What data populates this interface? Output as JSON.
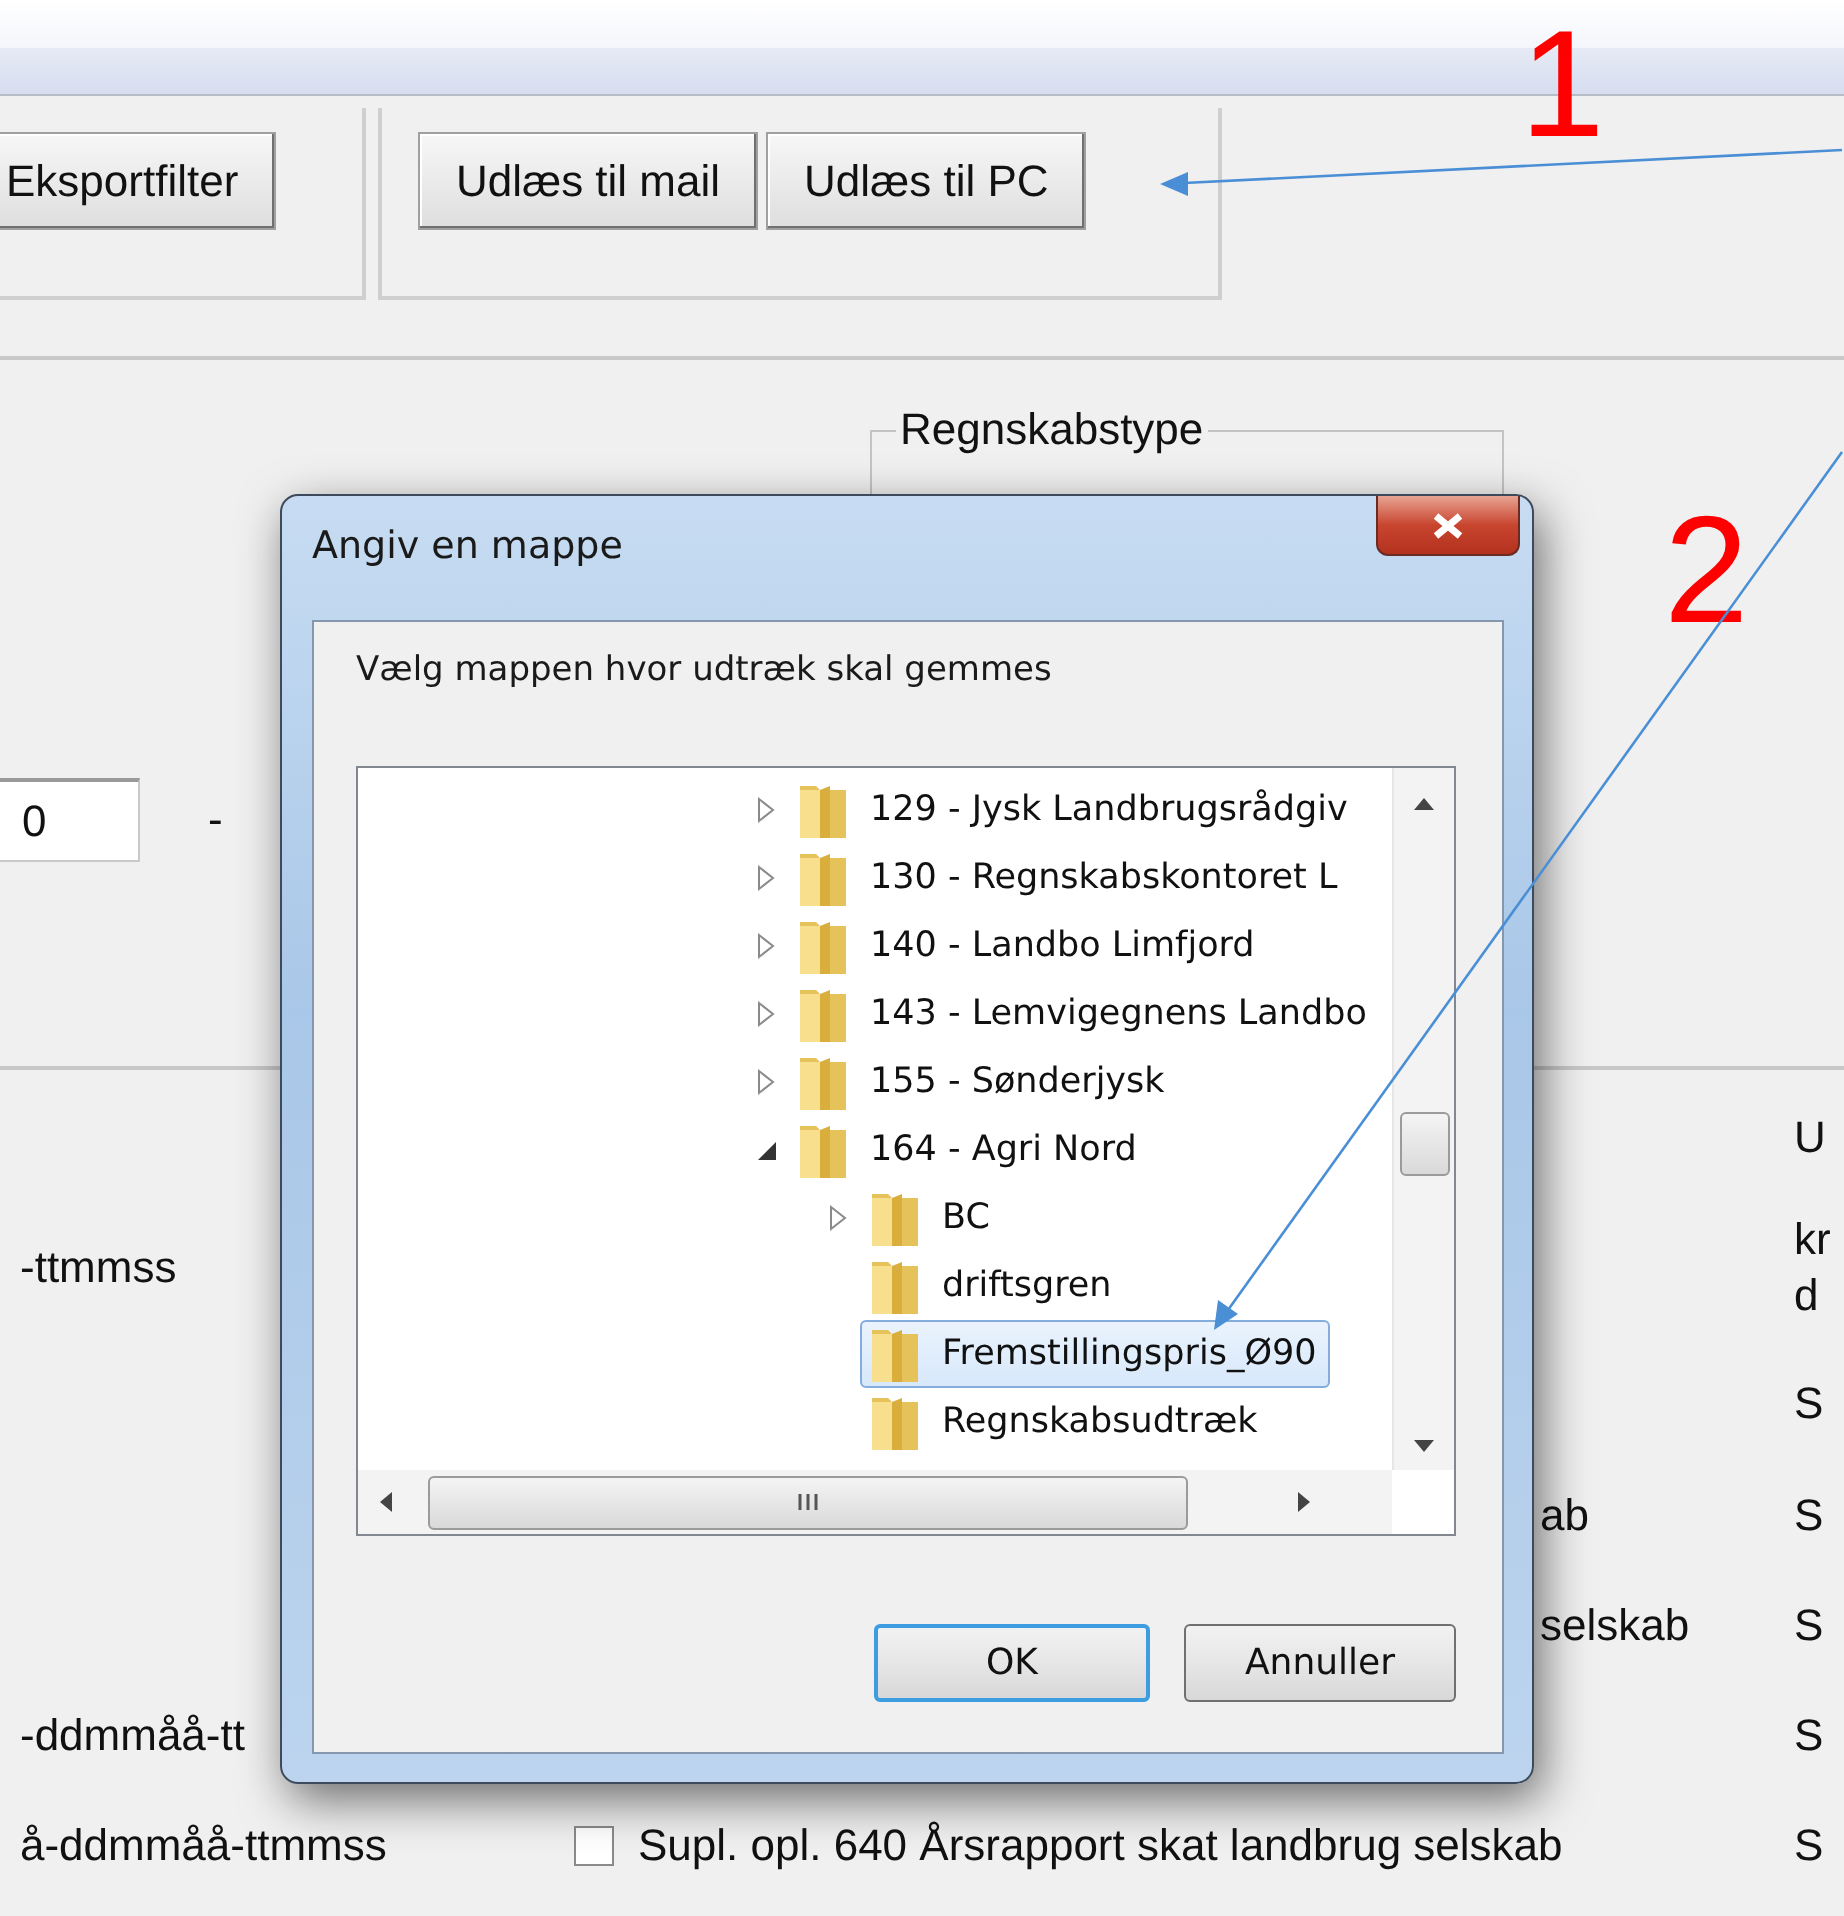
{
  "toolbar_groups": [
    {
      "buttons": [
        "Eksportfilter"
      ]
    },
    {
      "buttons": [
        "Udlæs til mail",
        "Udlæs til PC"
      ]
    }
  ],
  "filter": {
    "group_title": "Regnskabstype",
    "from_value": "0",
    "range_separator": "-"
  },
  "list_rows": [
    {
      "right": "U"
    },
    {
      "left": "-ttmmss",
      "right": "kr\nd"
    },
    {
      "right": "S"
    },
    {
      "middle": "ab",
      "right": "S"
    },
    {
      "middle": "selskab",
      "right": "S"
    },
    {
      "left": "-ddmmåå-tt",
      "right": "S"
    },
    {
      "left": "å-ddmmåå-ttmmss",
      "checkbox": {
        "label": "Supl. opl. 640 Årsrapport skat landbrug selskab",
        "checked": false
      },
      "right": "S"
    }
  ],
  "dialog": {
    "title": "Angiv en mappe",
    "prompt": "Vælg mappen hvor udtræk skal gemmes",
    "tree": [
      {
        "label": "129 - Jysk Landbrugsrådgiv",
        "expanded": false,
        "selected": false
      },
      {
        "label": "130 - Regnskabskontoret L",
        "expanded": false,
        "selected": false
      },
      {
        "label": "140 - Landbo Limfjord",
        "expanded": false,
        "selected": false
      },
      {
        "label": "143 - Lemvigegnens Landbo",
        "expanded": false,
        "selected": false
      },
      {
        "label": "155 - Sønderjysk",
        "expanded": false,
        "selected": false
      },
      {
        "label": "164 - Agri Nord",
        "expanded": true,
        "selected": false,
        "children": [
          {
            "label": "BC",
            "expanded": false,
            "selected": false
          },
          {
            "label": "driftsgren",
            "selected": false
          },
          {
            "label": "Fremstillingspris_Ø90",
            "selected": true
          },
          {
            "label": "Regnskabsudtræk",
            "selected": false
          }
        ]
      }
    ],
    "buttons": [
      {
        "label": "OK",
        "default": true
      },
      {
        "label": "Annuller",
        "default": false
      }
    ]
  },
  "annotations": [
    {
      "label": "1"
    },
    {
      "label": "2"
    }
  ]
}
